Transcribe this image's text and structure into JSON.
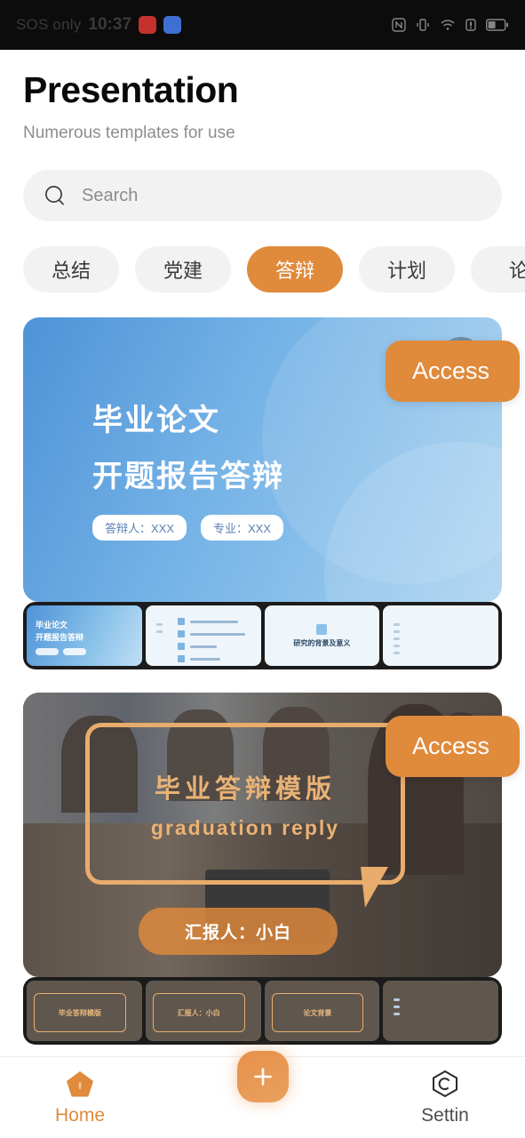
{
  "statusbar": {
    "carrier": "SOS only",
    "time": "10:37",
    "app_icons": [
      "red-app-icon",
      "blue-app-icon"
    ],
    "system_icons": [
      "nfc-icon",
      "vibrate-icon",
      "wifi-icon",
      "signal-icon",
      "battery-icon"
    ]
  },
  "header": {
    "title": "Presentation",
    "subtitle": "Numerous templates for use"
  },
  "search": {
    "placeholder": "Search",
    "value": "",
    "icon": "search-icon"
  },
  "chips": [
    {
      "label": "总结",
      "active": false
    },
    {
      "label": "党建",
      "active": false
    },
    {
      "label": "答辩",
      "active": true
    },
    {
      "label": "计划",
      "active": false
    },
    {
      "label": "论",
      "active": false
    }
  ],
  "cards": [
    {
      "name": "graduation-thesis-card",
      "title_line1": "毕业论文",
      "title_line2": "开题报告答辩",
      "badges": [
        "答辩人：XXX",
        "专业：XXX"
      ],
      "bookmark_icon": "bookmark-icon",
      "access_label": "Access",
      "thumbnails": [
        {
          "type": "cover",
          "title_line1": "毕业论文",
          "title_line2": "开题报告答辩"
        },
        {
          "type": "list"
        },
        {
          "type": "section",
          "caption": "研究的背景及意义"
        },
        {
          "type": "text"
        }
      ]
    },
    {
      "name": "graduation-reply-card",
      "bubble_cn": "毕业答辩模版",
      "bubble_en": "graduation reply",
      "reporter": "汇报人：小白",
      "bookmark_icon": "bookmark-icon",
      "access_label": "Access",
      "thumbnails": [
        {
          "type": "cover",
          "caption": "毕业答辩模版"
        },
        {
          "type": "bubble",
          "caption": "汇报人：小白"
        },
        {
          "type": "bubble",
          "caption": "论文背景"
        },
        {
          "type": "text"
        }
      ]
    }
  ],
  "bottom_nav": {
    "home_label": "Home",
    "home_icon": "home-icon",
    "settings_label": "Settin",
    "settings_icon": "settings-icon",
    "fab_icon": "plus-icon"
  },
  "colors": {
    "accent": "#e08a3c",
    "chip_bg": "#f2f2f2",
    "hero_blue": "#74b2e6",
    "bubble_orange": "#e8ac6c"
  }
}
